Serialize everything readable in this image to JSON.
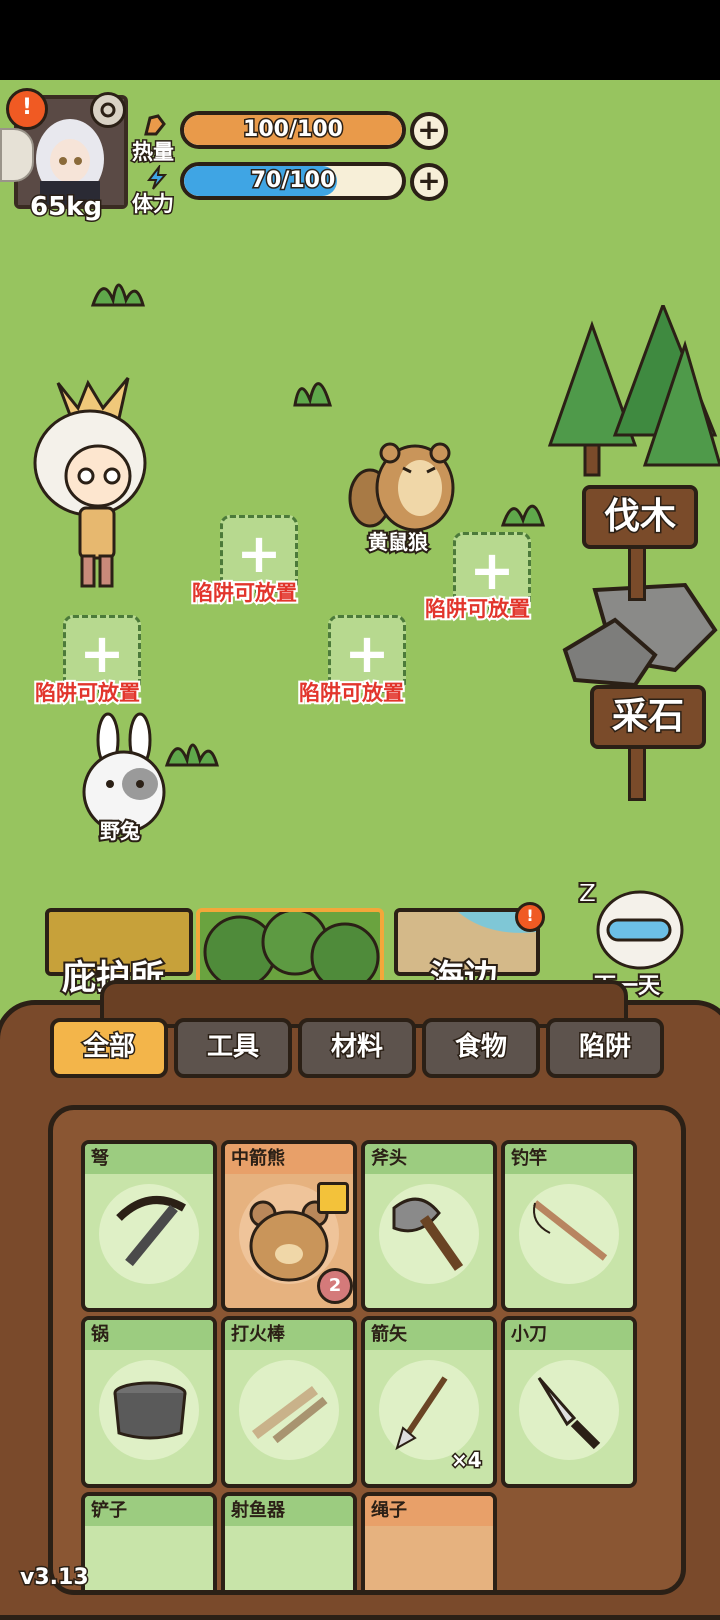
{
  "player": {
    "weight": "65kg",
    "alert": "!"
  },
  "stats": {
    "calories": {
      "label": "热量",
      "text": "100/100",
      "fraction": 1.0,
      "color": "#e99a4a"
    },
    "stamina": {
      "label": "体力",
      "text": "70/100",
      "fraction": 0.7,
      "color": "#3fa5e4"
    }
  },
  "map": {
    "traps": [
      {
        "label": "陷阱可放置"
      },
      {
        "label": "陷阱可放置"
      },
      {
        "label": "陷阱可放置"
      },
      {
        "label": "陷阱可放置"
      }
    ],
    "animals": {
      "weasel": "黄鼠狼",
      "rabbit": "野兔"
    },
    "actions": {
      "chop": "伐木",
      "mine": "采石"
    }
  },
  "locations": {
    "shelter": "庇护所",
    "forest": "森林",
    "beach": "海边",
    "next_day": "下一天",
    "beach_alert": "!"
  },
  "categories": [
    "全部",
    "工具",
    "材料",
    "食物",
    "陷阱"
  ],
  "active_category": "全部",
  "items": [
    {
      "name": "弩",
      "icon": "crossbow-icon"
    },
    {
      "name": "中箭熊",
      "icon": "wounded-bear-icon",
      "count": "2"
    },
    {
      "name": "斧头",
      "icon": "axe-icon"
    },
    {
      "name": "钓竿",
      "icon": "fishing-rod-icon"
    },
    {
      "name": "锅",
      "icon": "pot-icon"
    },
    {
      "name": "打火棒",
      "icon": "fire-drill-icon"
    },
    {
      "name": "箭矢",
      "icon": "arrow-icon",
      "count": "×4"
    },
    {
      "name": "小刀",
      "icon": "knife-icon"
    },
    {
      "name": "铲子",
      "icon": "shovel-icon"
    },
    {
      "name": "射鱼器",
      "icon": "fish-spear-icon"
    },
    {
      "name": "绳子",
      "icon": "rope-icon"
    }
  ],
  "version": "v3.13"
}
